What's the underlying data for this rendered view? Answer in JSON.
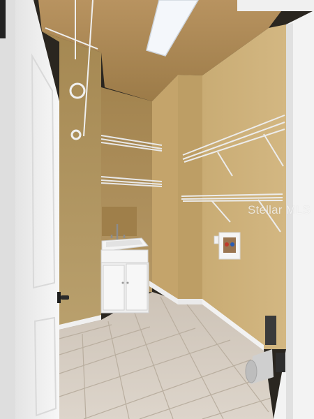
{
  "photo": {
    "watermark": "Stellar MLS",
    "colors": {
      "wall": "#b79a62",
      "wall_shadow": "#a2864f",
      "ceiling": "#a8854f",
      "floor": "#d8cfc4",
      "door": "#f2f2f2",
      "baseboard": "#eeeeee"
    }
  }
}
